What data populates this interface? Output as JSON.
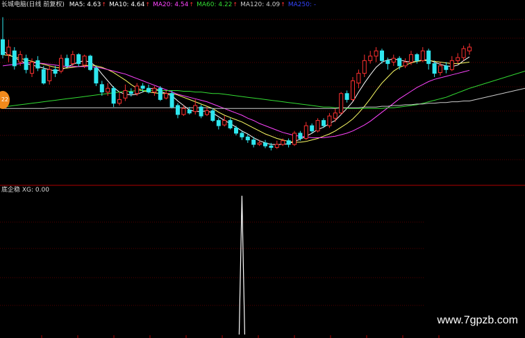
{
  "header": {
    "stock_label": "长城电脑(日线 前复权)",
    "indicators": [
      {
        "label": "MA5: 4.63",
        "color": "#ffffff",
        "arrow": "up",
        "arrow_color": "#ff3030"
      },
      {
        "label": "MA10: 4.64",
        "color": "#ffffff",
        "arrow": "up",
        "arrow_color": "#ff3030"
      },
      {
        "label": "MA20: 4.54",
        "color": "#ff44ff",
        "arrow": "up",
        "arrow_color": "#ff3030"
      },
      {
        "label": "MA60: 4.22",
        "color": "#33dd33",
        "arrow": "up",
        "arrow_color": "#ff3030"
      },
      {
        "label": "MA120: 4.09",
        "color": "#cccccc",
        "arrow": "up",
        "arrow_color": "#ff3030"
      },
      {
        "label": "MA250: -",
        "color": "#3344ff",
        "arrow": "",
        "arrow_color": "#3344ff"
      }
    ]
  },
  "sub_panel": {
    "label": "底企稳 XG: 0.00"
  },
  "side_badge": "22",
  "watermark": "www.7gpzb.com",
  "colors": {
    "up": "#ff3030",
    "down": "#2ee6ee",
    "grid": "#5a0000",
    "divider": "#b00000",
    "ma5": "#ffffff",
    "ma10": "#ffff66",
    "ma20": "#ff44ff",
    "ma60": "#33dd33",
    "ma120": "#cccccc"
  },
  "chart_data": {
    "type": "candlestick",
    "ylim": [
      3.3,
      5.6
    ],
    "candles": [
      [
        5.2,
        5.0,
        5.5,
        4.95
      ],
      [
        5.0,
        5.1,
        5.2,
        4.9
      ],
      [
        5.05,
        4.85,
        5.1,
        4.8
      ],
      [
        4.9,
        5.0,
        5.05,
        4.85
      ],
      [
        4.95,
        4.8,
        5.0,
        4.75
      ],
      [
        4.75,
        4.9,
        4.95,
        4.7
      ],
      [
        4.92,
        4.82,
        4.98,
        4.78
      ],
      [
        4.8,
        4.62,
        4.85,
        4.6
      ],
      [
        4.65,
        4.8,
        4.85,
        4.6
      ],
      [
        4.8,
        4.75,
        4.85,
        4.7
      ],
      [
        4.78,
        4.95,
        5.0,
        4.75
      ],
      [
        4.95,
        4.85,
        5.0,
        4.82
      ],
      [
        4.88,
        5.0,
        5.05,
        4.85
      ],
      [
        5.0,
        4.88,
        5.02,
        4.84
      ],
      [
        4.86,
        4.98,
        5.0,
        4.82
      ],
      [
        4.98,
        4.8,
        5.0,
        4.78
      ],
      [
        4.82,
        4.62,
        4.85,
        4.58
      ],
      [
        4.6,
        4.5,
        4.65,
        4.45
      ],
      [
        4.5,
        4.55,
        4.62,
        4.45
      ],
      [
        4.55,
        4.35,
        4.58,
        4.3
      ],
      [
        4.35,
        4.4,
        4.5,
        4.32
      ],
      [
        4.42,
        4.52,
        4.6,
        4.38
      ],
      [
        4.5,
        4.48,
        4.55,
        4.44
      ],
      [
        4.48,
        4.58,
        4.62,
        4.45
      ],
      [
        4.58,
        4.55,
        4.62,
        4.5
      ],
      [
        4.55,
        4.5,
        4.6,
        4.48
      ],
      [
        4.5,
        4.55,
        4.58,
        4.45
      ],
      [
        4.55,
        4.4,
        4.58,
        4.38
      ],
      [
        4.42,
        4.48,
        4.52,
        4.4
      ],
      [
        4.48,
        4.3,
        4.52,
        4.28
      ],
      [
        4.32,
        4.2,
        4.35,
        4.15
      ],
      [
        4.2,
        4.28,
        4.32,
        4.18
      ],
      [
        4.26,
        4.22,
        4.3,
        4.2
      ],
      [
        4.24,
        4.32,
        4.4,
        4.2
      ],
      [
        4.3,
        4.18,
        4.33,
        4.15
      ],
      [
        4.2,
        4.25,
        4.3,
        4.18
      ],
      [
        4.25,
        4.12,
        4.28,
        4.1
      ],
      [
        4.12,
        4.05,
        4.15,
        4.0
      ],
      [
        4.06,
        4.12,
        4.18,
        4.04
      ],
      [
        4.12,
        4.02,
        4.15,
        4.0
      ],
      [
        4.02,
        3.95,
        4.05,
        3.92
      ],
      [
        3.95,
        3.9,
        3.98,
        3.86
      ],
      [
        3.9,
        3.86,
        3.94,
        3.82
      ],
      [
        3.86,
        3.8,
        3.9,
        3.76
      ],
      [
        3.8,
        3.82,
        3.86,
        3.78
      ],
      [
        3.82,
        3.78,
        3.86,
        3.75
      ],
      [
        3.78,
        3.76,
        3.82,
        3.72
      ],
      [
        3.76,
        3.8,
        3.85,
        3.74
      ],
      [
        3.8,
        3.85,
        3.88,
        3.78
      ],
      [
        3.85,
        3.8,
        3.88,
        3.76
      ],
      [
        3.8,
        3.95,
        3.98,
        3.78
      ],
      [
        3.95,
        3.88,
        3.98,
        3.85
      ],
      [
        3.88,
        4.05,
        4.1,
        3.86
      ],
      [
        4.05,
        3.98,
        4.08,
        3.95
      ],
      [
        3.98,
        4.12,
        4.15,
        3.96
      ],
      [
        4.12,
        4.05,
        4.15,
        4.02
      ],
      [
        4.05,
        4.18,
        4.22,
        4.02
      ],
      [
        4.15,
        4.22,
        4.28,
        4.1
      ],
      [
        4.22,
        4.48,
        4.5,
        4.2
      ],
      [
        4.48,
        4.4,
        4.52,
        4.36
      ],
      [
        4.4,
        4.65,
        4.7,
        4.38
      ],
      [
        4.62,
        4.75,
        4.8,
        4.55
      ],
      [
        4.75,
        4.92,
        5.0,
        4.7
      ],
      [
        4.92,
        4.98,
        5.05,
        4.88
      ],
      [
        4.98,
        5.05,
        5.1,
        4.9
      ],
      [
        5.05,
        4.92,
        5.08,
        4.88
      ],
      [
        4.92,
        4.88,
        4.96,
        4.8
      ],
      [
        4.9,
        4.95,
        5.0,
        4.85
      ],
      [
        4.95,
        4.85,
        4.98,
        4.8
      ],
      [
        4.85,
        4.9,
        4.95,
        4.82
      ],
      [
        4.9,
        5.0,
        5.05,
        4.86
      ],
      [
        5.0,
        4.92,
        5.02,
        4.88
      ],
      [
        4.92,
        5.05,
        5.1,
        4.9
      ],
      [
        5.05,
        4.88,
        5.08,
        4.8
      ],
      [
        4.88,
        4.75,
        4.92,
        4.7
      ],
      [
        4.76,
        4.85,
        4.9,
        4.72
      ],
      [
        4.85,
        4.8,
        4.9,
        4.75
      ],
      [
        4.8,
        4.92,
        4.98,
        4.78
      ],
      [
        4.92,
        4.96,
        5.02,
        4.88
      ],
      [
        4.96,
        5.08,
        5.12,
        4.92
      ],
      [
        5.05,
        5.1,
        5.15,
        5.0
      ]
    ],
    "ma": {
      "ma5": [
        5.05,
        5.0,
        4.96,
        4.92,
        4.88,
        4.86,
        4.84,
        4.82,
        4.8,
        4.78,
        4.8,
        4.83,
        4.87,
        4.9,
        4.92,
        4.9,
        4.84,
        4.74,
        4.65,
        4.56,
        4.5,
        4.47,
        4.46,
        4.47,
        4.5,
        4.54,
        4.55,
        4.51,
        4.48,
        4.45,
        4.38,
        4.32,
        4.26,
        4.24,
        4.24,
        4.25,
        4.22,
        4.17,
        4.12,
        4.08,
        4.03,
        3.98,
        3.94,
        3.89,
        3.85,
        3.82,
        3.8,
        3.8,
        3.8,
        3.81,
        3.84,
        3.87,
        3.91,
        3.95,
        4.0,
        4.03,
        4.08,
        4.12,
        4.2,
        4.28,
        4.37,
        4.5,
        4.62,
        4.73,
        4.83,
        4.9,
        4.93,
        4.94,
        4.93,
        4.91,
        4.9,
        4.91,
        4.93,
        4.93,
        4.9,
        4.87,
        4.85,
        4.84,
        4.86,
        4.92,
        4.97
      ],
      "ma10": [
        5.0,
        4.99,
        4.97,
        4.95,
        4.93,
        4.91,
        4.89,
        4.87,
        4.85,
        4.83,
        4.82,
        4.82,
        4.83,
        4.84,
        4.85,
        4.86,
        4.85,
        4.83,
        4.8,
        4.76,
        4.71,
        4.66,
        4.6,
        4.55,
        4.52,
        4.5,
        4.49,
        4.48,
        4.48,
        4.48,
        4.46,
        4.43,
        4.4,
        4.37,
        4.34,
        4.31,
        4.28,
        4.23,
        4.19,
        4.16,
        4.13,
        4.1,
        4.06,
        4.02,
        3.98,
        3.94,
        3.91,
        3.88,
        3.86,
        3.84,
        3.83,
        3.83,
        3.84,
        3.86,
        3.88,
        3.91,
        3.94,
        3.98,
        4.03,
        4.08,
        4.14,
        4.22,
        4.31,
        4.41,
        4.52,
        4.62,
        4.7,
        4.78,
        4.83,
        4.86,
        4.89,
        4.91,
        4.92,
        4.92,
        4.91,
        4.9,
        4.89,
        4.88,
        4.88,
        4.89,
        4.9
      ],
      "ma20": [
        4.85,
        4.86,
        4.87,
        4.88,
        4.89,
        4.89,
        4.89,
        4.88,
        4.87,
        4.86,
        4.85,
        4.84,
        4.84,
        4.84,
        4.84,
        4.84,
        4.83,
        4.82,
        4.8,
        4.78,
        4.76,
        4.74,
        4.71,
        4.68,
        4.65,
        4.62,
        4.59,
        4.56,
        4.53,
        4.5,
        4.47,
        4.45,
        4.43,
        4.41,
        4.39,
        4.37,
        4.34,
        4.31,
        4.28,
        4.25,
        4.22,
        4.19,
        4.15,
        4.12,
        4.08,
        4.05,
        4.02,
        3.99,
        3.96,
        3.94,
        3.92,
        3.91,
        3.9,
        3.89,
        3.89,
        3.89,
        3.9,
        3.91,
        3.93,
        3.95,
        3.98,
        4.02,
        4.06,
        4.11,
        4.17,
        4.23,
        4.29,
        4.35,
        4.41,
        4.46,
        4.51,
        4.56,
        4.6,
        4.64,
        4.67,
        4.69,
        4.71,
        4.73,
        4.75,
        4.77,
        4.79
      ],
      "ma60": [
        4.3,
        4.31,
        4.32,
        4.33,
        4.34,
        4.35,
        4.36,
        4.37,
        4.38,
        4.39,
        4.4,
        4.41,
        4.42,
        4.43,
        4.44,
        4.45,
        4.46,
        4.47,
        4.48,
        4.49,
        4.5,
        4.51,
        4.51,
        4.52,
        4.52,
        4.52,
        4.52,
        4.52,
        4.52,
        4.52,
        4.52,
        4.51,
        4.51,
        4.5,
        4.5,
        4.49,
        4.48,
        4.48,
        4.47,
        4.46,
        4.45,
        4.44,
        4.43,
        4.42,
        4.41,
        4.4,
        4.39,
        4.38,
        4.37,
        4.36,
        4.35,
        4.34,
        4.33,
        4.32,
        4.31,
        4.3,
        4.3,
        4.29,
        4.29,
        4.28,
        4.28,
        4.28,
        4.28,
        4.28,
        4.28,
        4.28,
        4.29,
        4.29,
        4.3,
        4.31,
        4.32,
        4.33,
        4.35,
        4.37,
        4.39,
        4.41,
        4.43,
        4.46,
        4.49,
        4.52,
        4.55
      ],
      "ma120": [
        4.28,
        4.28,
        4.28,
        4.28,
        4.28,
        4.28,
        4.28,
        4.28,
        4.29,
        4.29,
        4.29,
        4.29,
        4.29,
        4.29,
        4.29,
        4.29,
        4.29,
        4.29,
        4.29,
        4.29,
        4.29,
        4.29,
        4.29,
        4.29,
        4.29,
        4.29,
        4.29,
        4.29,
        4.29,
        4.29,
        4.29,
        4.29,
        4.29,
        4.29,
        4.29,
        4.29,
        4.28,
        4.28,
        4.28,
        4.28,
        4.28,
        4.28,
        4.28,
        4.28,
        4.28,
        4.28,
        4.28,
        4.28,
        4.28,
        4.28,
        4.28,
        4.28,
        4.28,
        4.28,
        4.28,
        4.28,
        4.28,
        4.28,
        4.29,
        4.29,
        4.29,
        4.29,
        4.3,
        4.3,
        4.3,
        4.31,
        4.31,
        4.32,
        4.32,
        4.33,
        4.33,
        4.34,
        4.34,
        4.35,
        4.35,
        4.36,
        4.36,
        4.37,
        4.37,
        4.38,
        4.38
      ]
    },
    "xg": {
      "values_nonzero_index": 41,
      "peak_value": 1,
      "baseline": 0
    }
  }
}
